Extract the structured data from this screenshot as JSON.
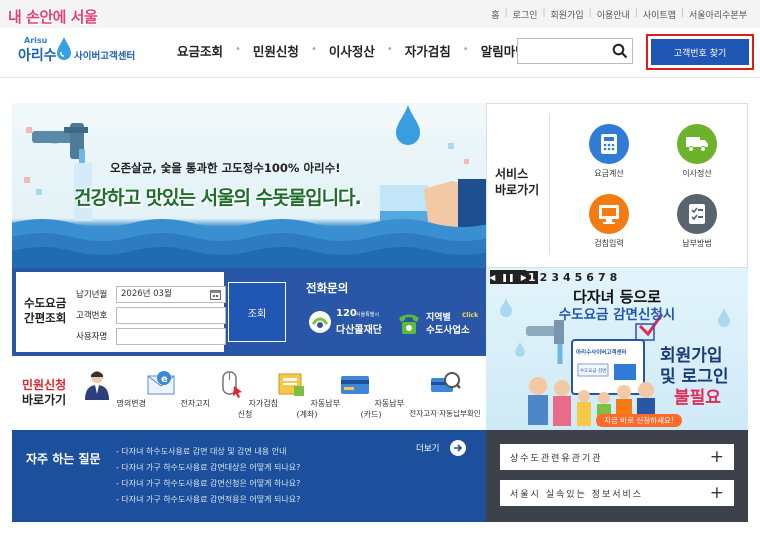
{
  "watermark": "내 손안에 서울",
  "utility_links": [
    "홈",
    "로그인",
    "회원가입",
    "이용안내",
    "사이트맵",
    "서울아리수본부"
  ],
  "logo": {
    "small": "Arisu",
    "main": "아리수",
    "sub": "사이버고객센터"
  },
  "nav": [
    "요금조회",
    "민원신청",
    "이사정산",
    "자가검침",
    "알림마당"
  ],
  "search": {
    "value": "",
    "placeholder": ""
  },
  "find_customer_button": "고객번호 찾기",
  "banner": {
    "subtitle": "오존살균, 숯을 통과한 고도정수100% 아리수!",
    "headline": "건강하고 맛있는 서울의 수돗물입니다."
  },
  "services": {
    "title_line1": "서비스",
    "title_line2": "바로가기",
    "items": [
      {
        "label": "요금계산",
        "color": "#2f7bd6"
      },
      {
        "label": "이사정산",
        "color": "#6cb22a"
      },
      {
        "label": "검침입력",
        "color": "#f47b12"
      },
      {
        "label": "납부방법",
        "color": "#59646f"
      }
    ]
  },
  "quick_lookup": {
    "title_line1": "수도요금",
    "title_line2": "간편조회",
    "labels": [
      "납기년월",
      "고객번호",
      "사용자명"
    ],
    "date_value": "2026년 03월",
    "customer_no_value": "",
    "user_name_value": "",
    "submit": "조회"
  },
  "phone": {
    "title": "전화문의",
    "dasan_num": "120",
    "dasan_small": "서울특별시",
    "dasan_name": "다산콜재단",
    "local_line1": "지역별",
    "local_click": "Click",
    "local_line2": "수도사업소"
  },
  "minwon": {
    "title_line1": "민원신청",
    "title_line2": "바로가기",
    "items": [
      "명의변경",
      "전자고지",
      "자가검침신청",
      "자동납부(계좌)",
      "자동납부(카드)",
      "전자고지·자동납부확인"
    ]
  },
  "faq": {
    "title": "자주 하는 질문",
    "more": "더보기",
    "items": [
      "- 다자녀 하수도사용료 감면 대상 및 감면 내용 안내",
      "- 다자녀 가구 하수도사용료 감면대상은 어떻게 되나요?",
      "- 다자녀 가구 하수도사용료 감면신청은 어떻게 하나요?",
      "- 다자녀 가구 하수도사용료 감면적용은 어떻게 되나요?"
    ]
  },
  "promo": {
    "pager_numbers": [
      "1",
      "2",
      "3",
      "4",
      "5",
      "6",
      "7",
      "8"
    ],
    "pager_active": "1",
    "line1": "다자녀 등으로",
    "line2_blue": "수도요금 감면신청시",
    "badge1": "회원가입",
    "badge2": "및 로그인",
    "badge3": "불필요",
    "screen_text": "아리수사이버고객센터",
    "screen_text2": "수도요금 감면",
    "cta": "지금 바로 신청하세요!"
  },
  "side_links": [
    "상수도관련유관기관",
    "서울시 실속있는 정보서비스"
  ]
}
